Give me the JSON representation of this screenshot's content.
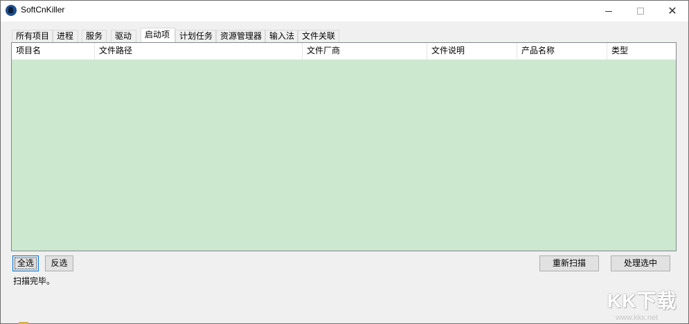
{
  "window": {
    "title": "SoftCnKiller"
  },
  "tabs": [
    {
      "label": "所有项目",
      "active": false
    },
    {
      "label": "进程",
      "active": false
    },
    {
      "label": "服务",
      "active": false
    },
    {
      "label": "驱动",
      "active": false
    },
    {
      "label": "启动项",
      "active": true
    },
    {
      "label": "计划任务",
      "active": false
    },
    {
      "label": "资源管理器",
      "active": false
    },
    {
      "label": "输入法",
      "active": false
    },
    {
      "label": "文件关联",
      "active": false
    }
  ],
  "table": {
    "columns": [
      "项目名",
      "文件路径",
      "文件厂商",
      "文件说明",
      "产品名称",
      "类型"
    ],
    "rows": [],
    "background_color": "#cce8cf"
  },
  "buttons": {
    "select_all": "全选",
    "invert_selection": "反选",
    "rescan": "重新扫描",
    "process_selected": "处理选中"
  },
  "status": {
    "text": "扫描完毕。"
  },
  "watermark": {
    "logo": "KK下载",
    "url": "www.kkx.net"
  }
}
